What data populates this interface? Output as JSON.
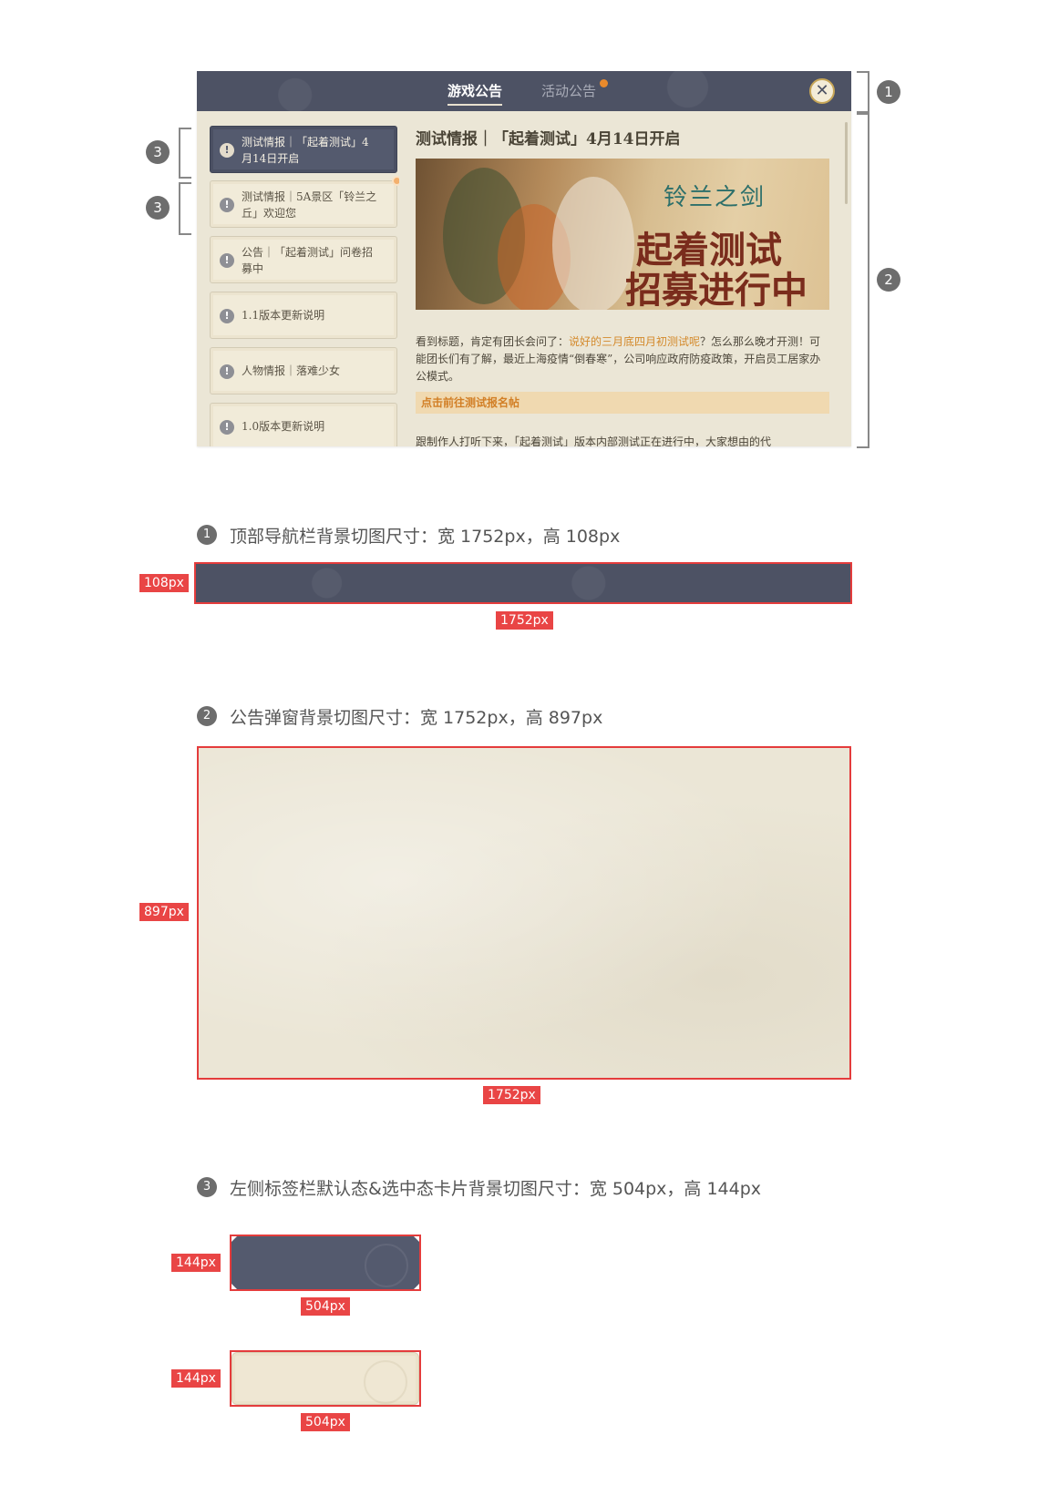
{
  "mockup": {
    "tabs": [
      {
        "label": "游戏公告",
        "active": true
      },
      {
        "label": "活动公告",
        "active": false
      }
    ],
    "close_icon": "close-icon",
    "list_items": [
      {
        "label": "测试情报｜「起着测试」4月14日开启",
        "selected": true
      },
      {
        "label": "测试情报｜5A景区「铃兰之丘」欢迎您",
        "selected": false,
        "badge": true
      },
      {
        "label": "公告｜「起着测试」问卷招募中",
        "selected": false
      },
      {
        "label": "1.1版本更新说明",
        "selected": false
      },
      {
        "label": "人物情报｜落难少女",
        "selected": false
      },
      {
        "label": "1.0版本更新说明",
        "selected": false
      }
    ],
    "content": {
      "title": "测试情报｜「起着测试」4月14日开启",
      "banner_logo": "铃兰之剑",
      "banner_line1": "起着测试",
      "banner_line2": "招募进行中",
      "para_prefix": "看到标题，肯定有团长会问了：",
      "para_highlight": "说好的三月底四月初测试呢",
      "para_suffix": "？怎么那么晚才开测！可能团长们有了解，最近上海疫情“倒春寒”，公司响应政府防疫政策，开启员工居家办公模式。",
      "link_text": "点击前往测试报名帖",
      "para2": "跟制作人打听下来，「起着测试」版本内部测试正在进行中，大家想由的代"
    },
    "markers": {
      "m1": "1",
      "m2": "2",
      "m3a": "3",
      "m3b": "3"
    }
  },
  "specs": {
    "s1": {
      "num": "1",
      "title": "顶部导航栏背景切图尺寸：宽 1752px，高 108px",
      "h_tag": "108px",
      "w_tag": "1752px"
    },
    "s2": {
      "num": "2",
      "title": "公告弹窗背景切图尺寸：宽 1752px，高 897px",
      "h_tag": "897px",
      "w_tag": "1752px"
    },
    "s3": {
      "num": "3",
      "title": "左侧标签栏默认态&选中态卡片背景切图尺寸：宽 504px，高 144px",
      "dark_h_tag": "144px",
      "dark_w_tag": "504px",
      "light_h_tag": "144px",
      "light_w_tag": "504px"
    }
  },
  "colors": {
    "nav_bg": "#4d5264",
    "panel_bg": "#ebe6d6",
    "highlight": "#d48a2c",
    "spec_red": "#e43c3c"
  }
}
